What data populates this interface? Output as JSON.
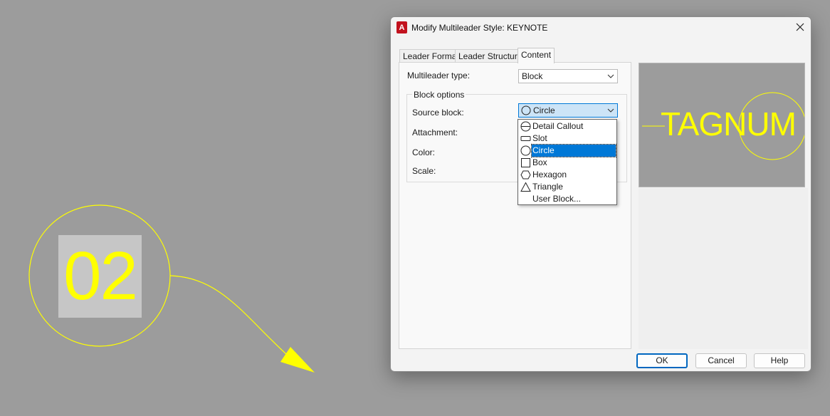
{
  "canvas": {
    "tag_text": "02",
    "colors": {
      "background": "#9c9c9c",
      "tag_highlight": "#c6c6c6",
      "annotation": "#ffff00"
    }
  },
  "dialog": {
    "title": "Modify Multileader Style: KEYNOTE",
    "app_icon": "autocad-icon",
    "close_icon": "close-icon",
    "tabs": [
      {
        "label": "Leader Format",
        "active": false
      },
      {
        "label": "Leader Structure",
        "active": false
      },
      {
        "label": "Content",
        "active": true
      }
    ],
    "content": {
      "multileader_type_label": "Multileader type:",
      "multileader_type_value": "Block",
      "block_options_label": "Block options",
      "source_block_label": "Source block:",
      "source_block_value": "Circle",
      "attachment_label": "Attachment:",
      "color_label": "Color:",
      "scale_label": "Scale:",
      "source_block_options": [
        {
          "label": "Detail Callout",
          "icon": "detail-callout-icon",
          "selected": false
        },
        {
          "label": "Slot",
          "icon": "slot-icon",
          "selected": false
        },
        {
          "label": "Circle",
          "icon": "circle-icon",
          "selected": true
        },
        {
          "label": "Box",
          "icon": "box-icon",
          "selected": false
        },
        {
          "label": "Hexagon",
          "icon": "hexagon-icon",
          "selected": false
        },
        {
          "label": "Triangle",
          "icon": "triangle-icon",
          "selected": false
        },
        {
          "label": "User Block...",
          "icon": "",
          "selected": false
        }
      ]
    },
    "preview_text": "TAGNUM",
    "buttons": {
      "ok": "OK",
      "cancel": "Cancel",
      "help": "Help"
    },
    "colors": {
      "accent": "#0078d7",
      "selected_row": "#0078d7",
      "combo_open": "#cce4f7"
    }
  }
}
